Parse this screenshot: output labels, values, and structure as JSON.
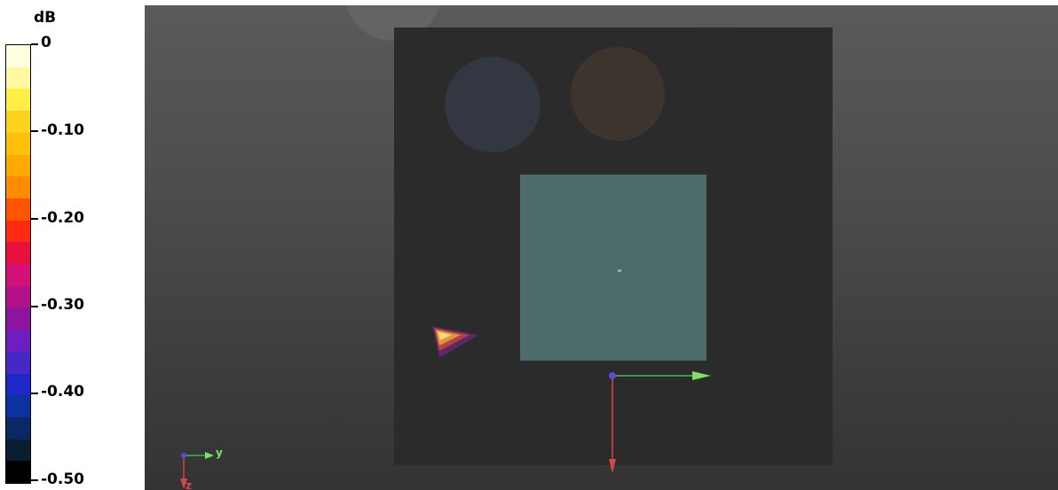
{
  "legend": {
    "unit": "dB",
    "tick_labels": [
      "0",
      "-0.10",
      "-0.20",
      "-0.30",
      "-0.40",
      "-0.50"
    ],
    "colors": [
      "#ffffe0",
      "#fff8a0",
      "#ffee44",
      "#ffd21e",
      "#ffc108",
      "#ffaa00",
      "#ff8c00",
      "#ff5400",
      "#ff2a10",
      "#e8103c",
      "#d21078",
      "#b4108c",
      "#8c14a0",
      "#6e1ebe",
      "#4628c8",
      "#1e28c8",
      "#0a32a0",
      "#0a2864",
      "#0a1e32",
      "#000000"
    ]
  },
  "viewport": {
    "local_axes": {
      "y_label": "y",
      "z_label": "z"
    }
  }
}
